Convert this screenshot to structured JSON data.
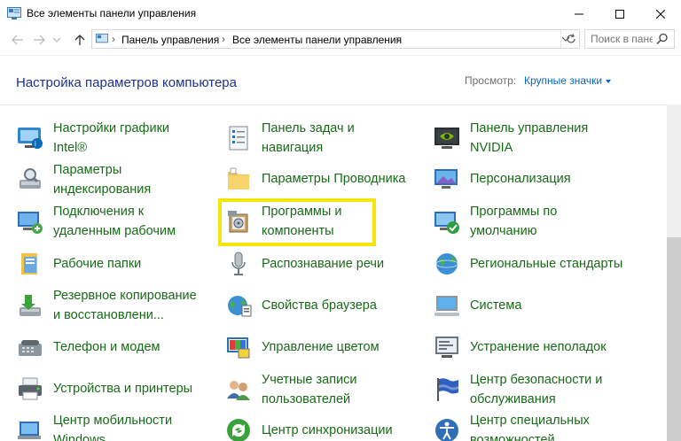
{
  "window": {
    "title": "Все элементы панели управления",
    "icon": "control-panel-icon"
  },
  "address": {
    "crumbs": [
      "Панель управления",
      "Все элементы панели управления"
    ]
  },
  "search": {
    "placeholder": "Поиск в пане..."
  },
  "header": {
    "title": "Настройка параметров компьютера",
    "view_label": "Просмотр:",
    "view_value": "Крупные значки"
  },
  "items": {
    "col1": [
      {
        "label1": "Настройки графики",
        "label2": "Intel®",
        "icon": "intel-graphics-icon"
      },
      {
        "label1": "Параметры",
        "label2": "индексирования",
        "icon": "indexing-icon"
      },
      {
        "label1": "Подключения к",
        "label2": "удаленным рабочим",
        "icon": "remote-desktop-icon"
      },
      {
        "label1": "Рабочие папки",
        "label2": "",
        "icon": "work-folders-icon"
      },
      {
        "label1": "Резервное копирование",
        "label2": "и восстановлени...",
        "icon": "backup-icon"
      },
      {
        "label1": "Телефон и модем",
        "label2": "",
        "icon": "phone-modem-icon"
      },
      {
        "label1": "Устройства и принтеры",
        "label2": "",
        "icon": "printer-icon"
      },
      {
        "label1": "Центр мобильности",
        "label2": "Windows",
        "icon": "mobility-center-icon"
      }
    ],
    "col2": [
      {
        "label1": "Панель задач и",
        "label2": "навигация",
        "icon": "taskbar-icon"
      },
      {
        "label1": "Параметры Проводника",
        "label2": "",
        "icon": "explorer-options-icon"
      },
      {
        "label1": "Программы и",
        "label2": "компоненты",
        "icon": "programs-icon"
      },
      {
        "label1": "Распознавание речи",
        "label2": "",
        "icon": "microphone-icon"
      },
      {
        "label1": "Свойства браузера",
        "label2": "",
        "icon": "internet-options-icon"
      },
      {
        "label1": "Управление цветом",
        "label2": "",
        "icon": "color-management-icon"
      },
      {
        "label1": "Учетные записи",
        "label2": "пользователей",
        "icon": "user-accounts-icon"
      },
      {
        "label1": "Центр синхронизации",
        "label2": "",
        "icon": "sync-center-icon"
      }
    ],
    "col3": [
      {
        "label1": "Панель управления",
        "label2": "NVIDIA",
        "icon": "nvidia-icon"
      },
      {
        "label1": "Персонализация",
        "label2": "",
        "icon": "personalization-icon"
      },
      {
        "label1": "Программы по",
        "label2": "умолчанию",
        "icon": "default-programs-icon"
      },
      {
        "label1": "Региональные стандарты",
        "label2": "",
        "icon": "region-icon"
      },
      {
        "label1": "Система",
        "label2": "",
        "icon": "system-icon"
      },
      {
        "label1": "Устранение неполадок",
        "label2": "",
        "icon": "troubleshooting-icon"
      },
      {
        "label1": "Центр безопасности и",
        "label2": "обслуживания",
        "icon": "security-flag-icon"
      },
      {
        "label1": "Центр специальных",
        "label2": "возможностей",
        "icon": "accessibility-icon"
      }
    ]
  },
  "colors": {
    "link_green": "#186a18",
    "title_blue": "#1e3287",
    "highlight": "#f2e60b"
  }
}
